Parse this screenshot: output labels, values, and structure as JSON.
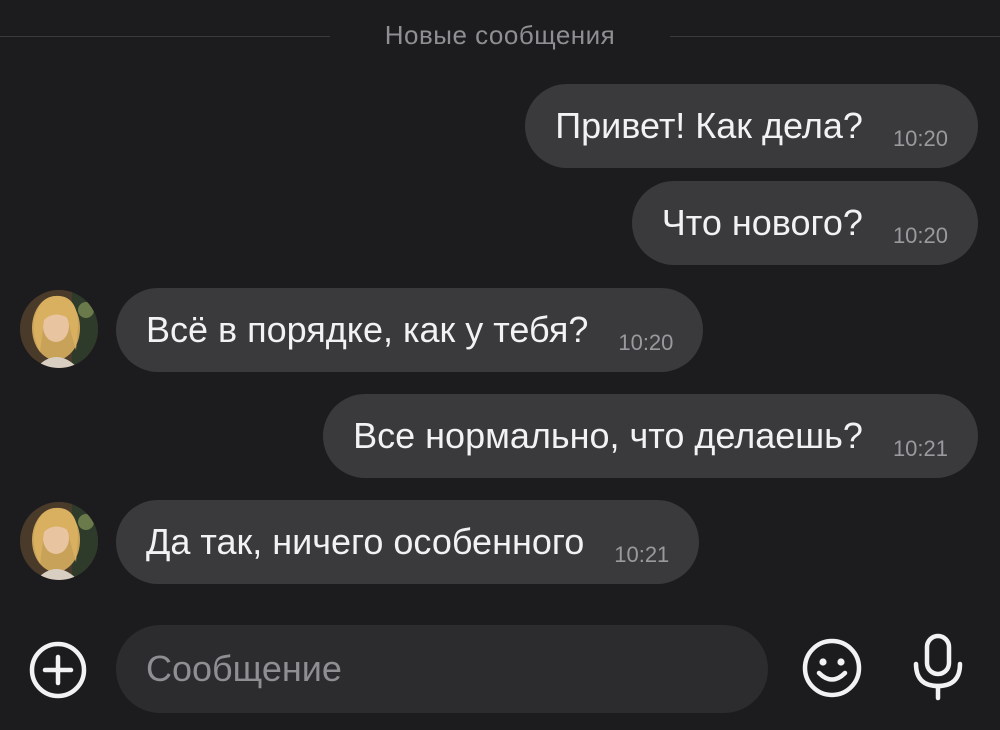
{
  "divider": {
    "label": "Новые сообщения"
  },
  "messages": [
    {
      "direction": "outgoing",
      "text": "Привет! Как дела?",
      "time": "10:20"
    },
    {
      "direction": "outgoing",
      "text": "Что нового?",
      "time": "10:20"
    },
    {
      "direction": "incoming",
      "text": "Всё в порядке, как у тебя?",
      "time": "10:20",
      "avatar": "contact-avatar"
    },
    {
      "direction": "outgoing",
      "text": "Все нормально, что делаешь?",
      "time": "10:21"
    },
    {
      "direction": "incoming",
      "text": "Да так, ничего особенного",
      "time": "10:21",
      "avatar": "contact-avatar"
    }
  ],
  "composer": {
    "placeholder": "Сообщение",
    "icons": [
      "plus-icon",
      "emoji-icon",
      "microphone-icon"
    ]
  },
  "colors": {
    "background": "#1c1c1e",
    "bubble": "#3a3a3c",
    "input": "#2c2c2e",
    "text": "#f2f2f4",
    "muted": "#8e8e93"
  }
}
